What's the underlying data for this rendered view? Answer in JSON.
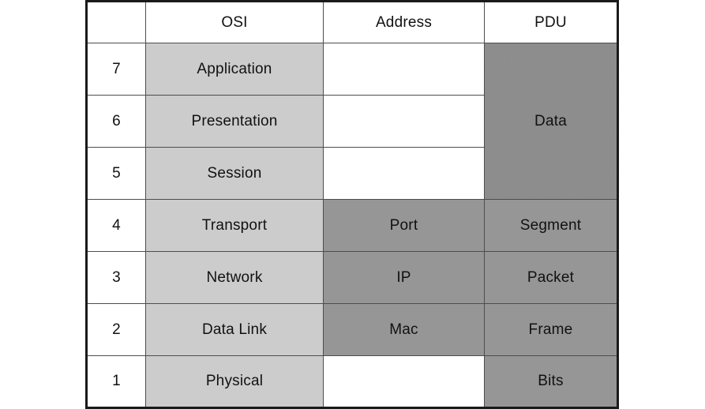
{
  "table": {
    "headers": {
      "layer_number": "",
      "osi": "OSI",
      "address": "Address",
      "pdu": "PDU"
    },
    "rows": [
      {
        "number": "7",
        "osi": "Application",
        "address": "",
        "pdu": ""
      },
      {
        "number": "6",
        "osi": "Presentation",
        "address": "",
        "pdu": "Data"
      },
      {
        "number": "5",
        "osi": "Session",
        "address": "",
        "pdu": ""
      },
      {
        "number": "4",
        "osi": "Transport",
        "address": "Port",
        "pdu": "Segment"
      },
      {
        "number": "3",
        "osi": "Network",
        "address": "IP",
        "pdu": "Packet"
      },
      {
        "number": "2",
        "osi": "Data Link",
        "address": "Mac",
        "pdu": "Frame"
      },
      {
        "number": "1",
        "osi": "Physical",
        "address": "",
        "pdu": "Bits"
      }
    ],
    "colors": {
      "page_background": "#ffffff",
      "osi_cell": "#cccccc",
      "address_pdu_cell": "#969696",
      "data_block": "#919191",
      "border": "#4d4d4d",
      "outer_border": "#1a1a1a",
      "text": "#111111"
    }
  }
}
